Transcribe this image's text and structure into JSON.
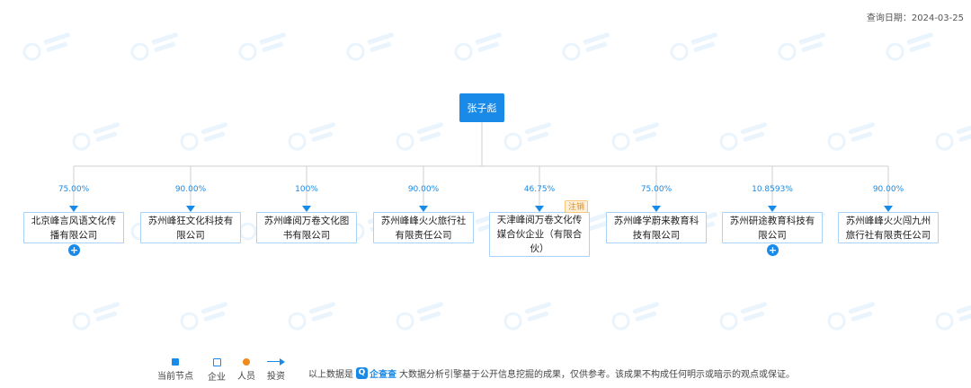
{
  "header": {
    "query_date": "查询日期：2024-03-25"
  },
  "root": {
    "name": "张子彪"
  },
  "children": [
    {
      "percent": "75.00%",
      "name": "北京峰言风语文化传播有限公司",
      "expandable": true
    },
    {
      "percent": "90.00%",
      "name": "苏州峰狂文化科技有限公司"
    },
    {
      "percent": "100%",
      "name": "苏州峰阅万卷文化图书有限公司"
    },
    {
      "percent": "90.00%",
      "name": "苏州峰峰火火旅行社有限责任公司"
    },
    {
      "percent": "46.75%",
      "name": "天津峰阅万卷文化传媒合伙企业（有限合伙）",
      "badge": "注销"
    },
    {
      "percent": "75.00%",
      "name": "苏州峰学蔚来教育科技有限公司"
    },
    {
      "percent": "10.8593%",
      "name": "苏州研途教育科技有限公司",
      "expandable": true
    },
    {
      "percent": "90.00%",
      "name": "苏州峰峰火火闯九州旅行社有限责任公司"
    }
  ],
  "legend": {
    "current_node": "当前节点",
    "company": "企业",
    "person": "人员",
    "investment": "投资"
  },
  "footer": {
    "disclaimer_prefix": "以上数据是",
    "brand_name": "企查查",
    "disclaimer_suffix": "大数据分析引擎基于公开信息挖掘的成果，仅供参考。该成果不构成任何明示或暗示的观点或保证。"
  },
  "colors": {
    "accent": "#1a8ae8",
    "badge": "#e08a12",
    "person_dot": "#f08a1c"
  },
  "icons": {
    "expand": "plus-icon",
    "watermark": "qcc-logo-icon",
    "brand": "qcc-logo-icon"
  }
}
